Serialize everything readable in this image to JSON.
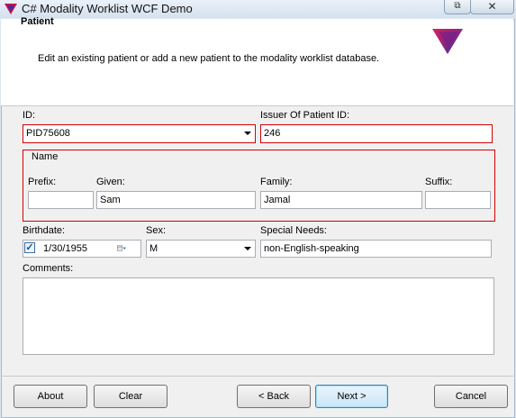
{
  "window": {
    "title": "C# Modality Worklist WCF Demo",
    "icon": "app-logo-icon",
    "restore_glyph": "⧉",
    "close_glyph": "✕"
  },
  "header": {
    "title": "Patient",
    "subtitle": "Edit an existing patient or add a new patient to the modality worklist database."
  },
  "form": {
    "id": {
      "label": "ID:",
      "value": "PID75608"
    },
    "issuer": {
      "label": "Issuer Of Patient ID:",
      "value": "246"
    },
    "name": {
      "legend": "Name",
      "prefix": {
        "label": "Prefix:",
        "value": ""
      },
      "given": {
        "label": "Given:",
        "value": "Sam"
      },
      "family": {
        "label": "Family:",
        "value": "Jamal"
      },
      "suffix": {
        "label": "Suffix:",
        "value": ""
      }
    },
    "birthdate": {
      "label": "Birthdate:",
      "value": "1/30/1955",
      "checked": true,
      "check_glyph": "✓"
    },
    "sex": {
      "label": "Sex:",
      "value": "M"
    },
    "special_needs": {
      "label": "Special Needs:",
      "value": "non-English-speaking"
    },
    "comments": {
      "label": "Comments:",
      "value": ""
    }
  },
  "buttons": {
    "about": "About",
    "clear": "Clear",
    "back": "< Back",
    "next": "Next >",
    "cancel": "Cancel"
  },
  "colors": {
    "error_border": "#d40000",
    "logo_top": "#c0164f",
    "logo_bottom": "#4a2a9a"
  }
}
